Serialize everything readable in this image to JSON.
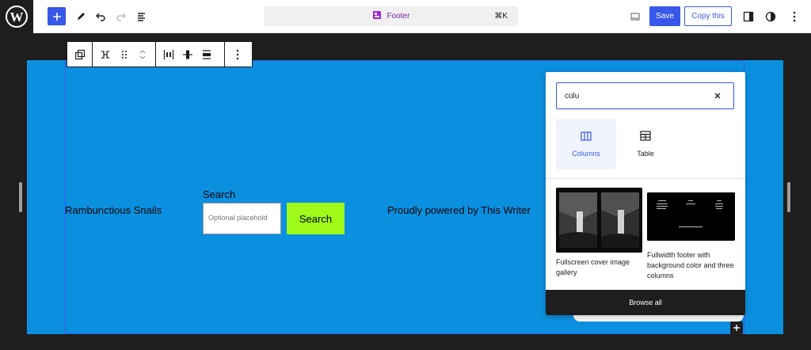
{
  "topbar": {
    "document_title": "Footer",
    "command_shortcut": "⌘K",
    "save_label": "Save",
    "copy_label": "Copy this",
    "accent_color": "#3858e9"
  },
  "canvas": {
    "background_color": "#0b90e0",
    "site_title": "Rambunctious Snails",
    "search": {
      "label": "Search",
      "placeholder": "Optional placehold",
      "button_label": "Search",
      "button_color": "#9ff919"
    },
    "powered_by": "Proudly powered by This Writer"
  },
  "inserter": {
    "search_value": "colu",
    "blocks": [
      {
        "label": "Columns",
        "icon": "columns-icon",
        "selected": true
      },
      {
        "label": "Table",
        "icon": "table-icon",
        "selected": false
      }
    ],
    "patterns": [
      {
        "caption": "Fullscreen cover image gallery"
      },
      {
        "caption": "Fullwidth footer with background color and three columns"
      }
    ],
    "browse_all_label": "Browse all"
  }
}
